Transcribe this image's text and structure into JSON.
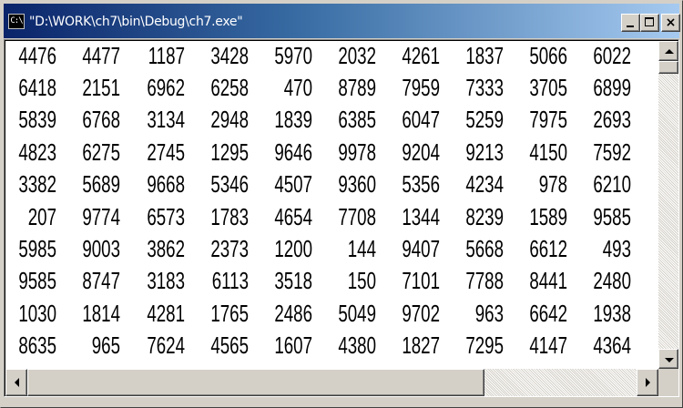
{
  "window": {
    "title": "\"D:\\WORK\\ch7\\bin\\Debug\\ch7.exe\"",
    "app_icon_text": "C:\\",
    "buttons": {
      "minimize": "minimize",
      "maximize": "maximize",
      "close": "×"
    }
  },
  "console": {
    "rows": [
      [
        "4476",
        "4477",
        "1187",
        "3428",
        "5970",
        "2032",
        "4261",
        "1837",
        "5066",
        "6022"
      ],
      [
        "6418",
        "2151",
        "6962",
        "6258",
        "470",
        "8789",
        "7959",
        "7333",
        "3705",
        "6899"
      ],
      [
        "5839",
        "6768",
        "3134",
        "2948",
        "1839",
        "6385",
        "6047",
        "5259",
        "7975",
        "2693"
      ],
      [
        "4823",
        "6275",
        "2745",
        "1295",
        "9646",
        "9978",
        "9204",
        "9213",
        "4150",
        "7592"
      ],
      [
        "3382",
        "5689",
        "9668",
        "5346",
        "4507",
        "9360",
        "5356",
        "4234",
        "978",
        "6210"
      ],
      [
        "207",
        "9774",
        "6573",
        "1783",
        "4654",
        "7708",
        "1344",
        "8239",
        "1589",
        "9585"
      ],
      [
        "5985",
        "9003",
        "3862",
        "2373",
        "1200",
        "144",
        "9407",
        "5668",
        "6612",
        "493"
      ],
      [
        "9585",
        "8747",
        "3183",
        "6113",
        "3518",
        "150",
        "7101",
        "7788",
        "8441",
        "2480"
      ],
      [
        "1030",
        "1814",
        "4281",
        "1765",
        "2486",
        "5049",
        "9702",
        "963",
        "6642",
        "1938"
      ],
      [
        "8635",
        "965",
        "7624",
        "4565",
        "1607",
        "4380",
        "1827",
        "7295",
        "4147",
        "4364"
      ]
    ]
  },
  "scrollbars": {
    "vertical": {
      "position": 0.0,
      "visible_fraction": 0.04
    },
    "horizontal": {
      "position": 0.0,
      "visible_fraction": 0.75
    }
  }
}
